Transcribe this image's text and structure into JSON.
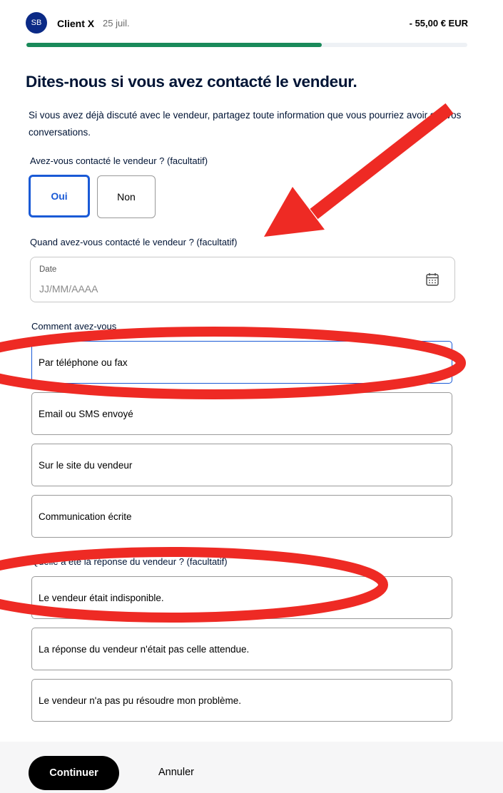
{
  "header": {
    "avatar_initials": "SB",
    "merchant": "Client X",
    "date": "25 juil.",
    "amount": "- 55,00 € EUR",
    "progress_fraction": 0.67
  },
  "page": {
    "title": "Dites-nous si vous avez contacté le vendeur.",
    "intro": "Si vous avez déjà discuté avec le vendeur, partagez toute information que vous pourriez avoir sur vos conversations."
  },
  "contacted": {
    "label": "Avez-vous contacté le vendeur ? (facultatif)",
    "yes": "Oui",
    "no": "Non",
    "selected": "Oui"
  },
  "when": {
    "label": "Quand avez-vous contacté le vendeur ? (facultatif)",
    "field_label": "Date",
    "placeholder": "JJ/MM/AAAA",
    "icon": "calendar-icon"
  },
  "how": {
    "label": "Comment avez-vous",
    "options": [
      "Par téléphone ou fax",
      "Email ou SMS envoyé",
      "Sur le site du vendeur",
      "Communication écrite"
    ]
  },
  "response": {
    "label": "Quelle a été la réponse du vendeur ? (facultatif)",
    "options": [
      "Le vendeur était indisponible.",
      "La réponse du vendeur n'était pas celle attendue.",
      "Le vendeur n'a pas pu résoudre mon problème."
    ]
  },
  "footer": {
    "continue": "Continuer",
    "cancel": "Annuler"
  },
  "colors": {
    "brand_blue": "#0b2a86",
    "selected_blue": "#1a5ad6",
    "progress_green": "#1a8a5a",
    "annotation_red": "#ee2a24"
  }
}
